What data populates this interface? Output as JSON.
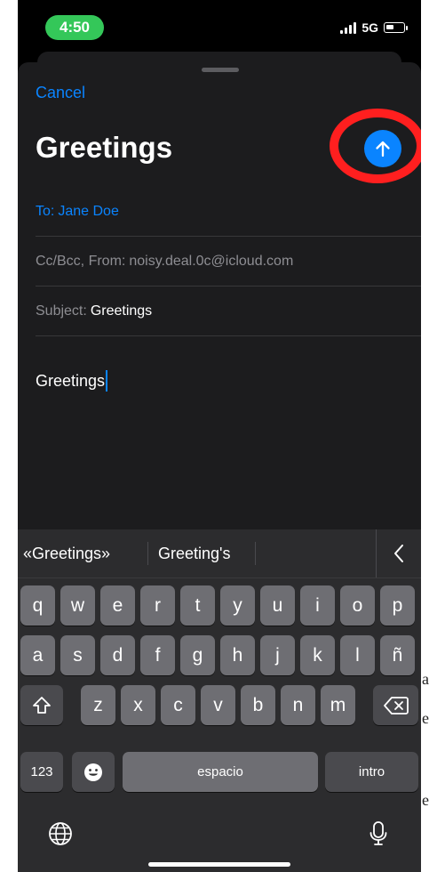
{
  "status_bar": {
    "time": "4:50",
    "network": "5G"
  },
  "compose": {
    "cancel_label": "Cancel",
    "title": "Greetings",
    "to_label": "To:",
    "to_value": "Jane Doe",
    "from_label": "Cc/Bcc, From:",
    "from_value": "noisy.deal.0c@icloud.com",
    "subject_label": "Subject:",
    "subject_value": "Greetings",
    "body": "Greetings",
    "send_button_icon": "arrow-up-icon",
    "highlight_color": "#ff1f1f"
  },
  "keyboard": {
    "predictions": [
      "«Greetings»",
      "Greeting's"
    ],
    "collapse_icon": "chevron-left-icon",
    "row1": [
      "q",
      "w",
      "e",
      "r",
      "t",
      "y",
      "u",
      "i",
      "o",
      "p"
    ],
    "row2": [
      "a",
      "s",
      "d",
      "f",
      "g",
      "h",
      "j",
      "k",
      "l",
      "ñ"
    ],
    "row3": [
      "z",
      "x",
      "c",
      "v",
      "b",
      "n",
      "m"
    ],
    "numbers_key": "123",
    "space_key": "espacio",
    "return_key": "intro",
    "icons": {
      "shift": "shift-icon",
      "delete": "delete-icon",
      "emoji": "emoji-icon",
      "globe": "globe-icon",
      "microphone": "microphone-icon"
    }
  },
  "colors": {
    "accent": "#0a84ff",
    "status_green": "#34c759",
    "keyboard_bg": "#2c2c2e"
  },
  "margin_marks": [
    "a",
    "e",
    "e"
  ]
}
